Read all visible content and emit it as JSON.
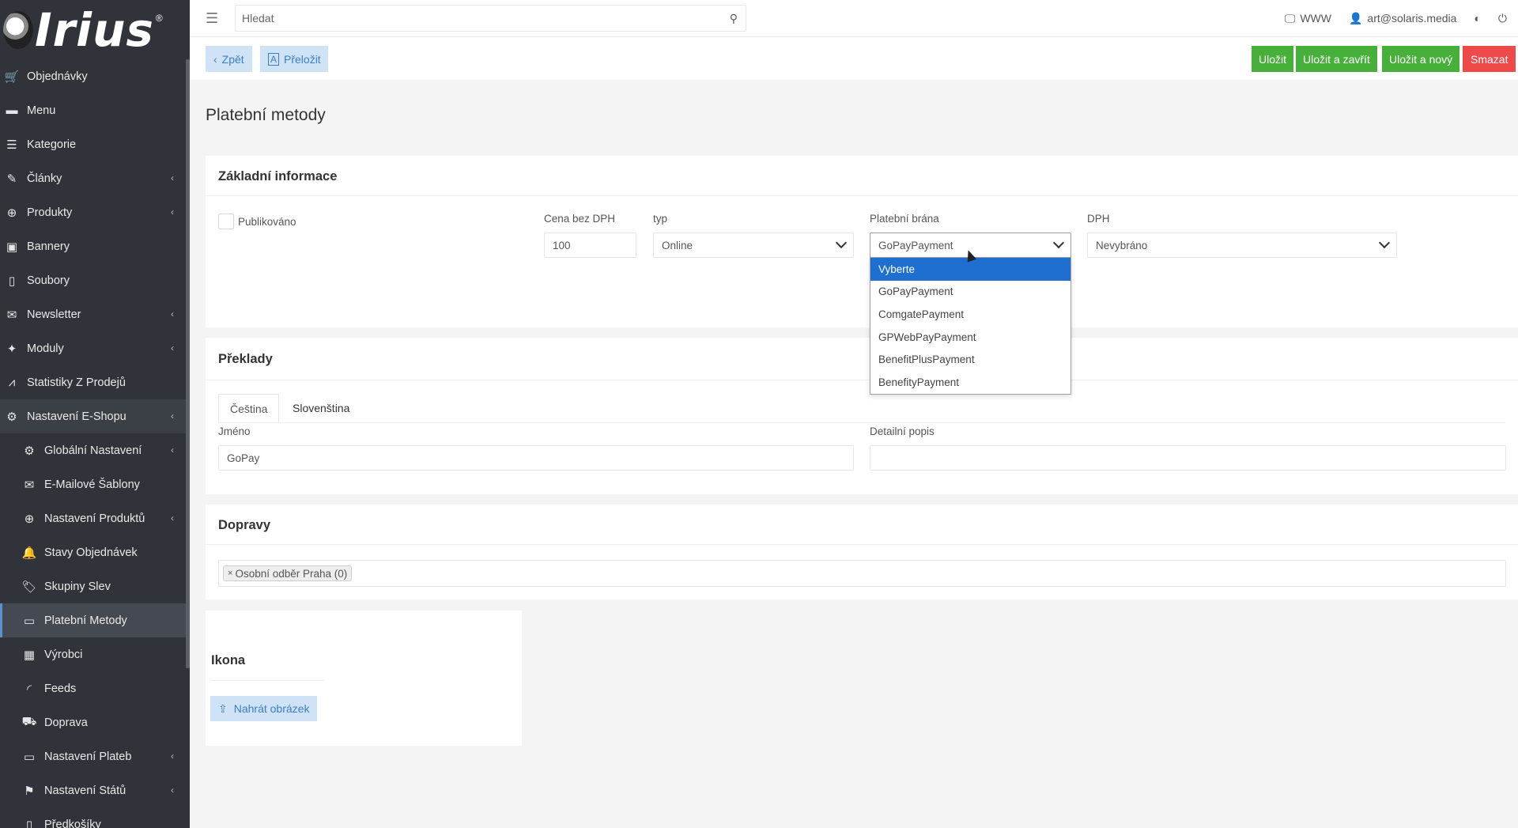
{
  "app": {
    "logo_text": "Irius",
    "logo_reg": "®"
  },
  "sidebar": {
    "items": [
      {
        "label": "Objednávky",
        "icon": "cart-icon",
        "glyph": "🛒",
        "chev": false
      },
      {
        "label": "Menu",
        "icon": "folder-icon",
        "glyph": "▬",
        "chev": false
      },
      {
        "label": "Kategorie",
        "icon": "list-icon",
        "glyph": "☰",
        "chev": false
      },
      {
        "label": "Články",
        "icon": "pencil-icon",
        "glyph": "✎",
        "chev": true
      },
      {
        "label": "Produkty",
        "icon": "globe-icon",
        "glyph": "⊕",
        "chev": true
      },
      {
        "label": "Bannery",
        "icon": "image-icon",
        "glyph": "▣",
        "chev": false
      },
      {
        "label": "Soubory",
        "icon": "file-icon",
        "glyph": "▯",
        "chev": false
      },
      {
        "label": "Newsletter",
        "icon": "mail-icon",
        "glyph": "✉",
        "chev": true
      },
      {
        "label": "Moduly",
        "icon": "puzzle-icon",
        "glyph": "✦",
        "chev": true
      },
      {
        "label": "Statistiky Z Prodejů",
        "icon": "chart-icon",
        "glyph": "⩘",
        "chev": false
      },
      {
        "label": "Nastavení E-Shopu",
        "icon": "cogs-icon",
        "glyph": "⚙",
        "chev": true,
        "open": true
      }
    ],
    "subitems": [
      {
        "label": "Globální Nastavení",
        "icon": "gear-icon",
        "glyph": "⚙",
        "chev": true
      },
      {
        "label": "E-Mailové Šablony",
        "icon": "envelope-icon",
        "glyph": "✉",
        "chev": false
      },
      {
        "label": "Nastavení Produktů",
        "icon": "globe-icon",
        "glyph": "⊕",
        "chev": true
      },
      {
        "label": "Stavy Objednávek",
        "icon": "bell-icon",
        "glyph": "🔔",
        "chev": false
      },
      {
        "label": "Skupiny Slev",
        "icon": "tag-icon",
        "glyph": "🏷",
        "chev": false
      },
      {
        "label": "Platební Metody",
        "icon": "credit-card-icon",
        "glyph": "▭",
        "chev": false,
        "active": true
      },
      {
        "label": "Výrobci",
        "icon": "building-icon",
        "glyph": "▦",
        "chev": false
      },
      {
        "label": "Feeds",
        "icon": "rss-icon",
        "glyph": "◜",
        "chev": false
      },
      {
        "label": "Doprava",
        "icon": "truck-icon",
        "glyph": "⛟",
        "chev": false
      },
      {
        "label": "Nastavení Plateb",
        "icon": "credit-card-icon",
        "glyph": "▭",
        "chev": true
      },
      {
        "label": "Nastavení Států",
        "icon": "flag-icon",
        "glyph": "⚑",
        "chev": true
      },
      {
        "label": "Předkošíky",
        "icon": "file-icon",
        "glyph": "▯",
        "chev": false
      }
    ]
  },
  "topbar": {
    "search_placeholder": "Hledat",
    "www_label": "WWW",
    "user_email": "art@solaris.media"
  },
  "actions": {
    "back": "Zpět",
    "translate": "Přeložit",
    "save": "Uložit",
    "save_close": "Uložit a zavřít",
    "save_new": "Uložit a nový",
    "delete": "Smazat"
  },
  "page": {
    "title": "Platební metody"
  },
  "basic": {
    "title": "Základní informace",
    "published_label": "Publikováno",
    "price_label": "Cena bez DPH",
    "price_value": "100",
    "type_label": "typ",
    "type_value": "Online",
    "gateway_label": "Platební brána",
    "gateway_value": "GoPayPayment",
    "vat_label": "DPH",
    "vat_value": "Nevybráno"
  },
  "dropdown": {
    "options": [
      "Vyberte",
      "GoPayPayment",
      "ComgatePayment",
      "GPWebPayPayment",
      "BenefitPlusPayment",
      "BenefityPayment"
    ]
  },
  "translations": {
    "title": "Překlady",
    "tab_cs": "Čeština",
    "tab_sk": "Slovenština",
    "name_label": "Jméno",
    "name_value": "GoPay",
    "desc_label": "Detailní popis",
    "desc_value": ""
  },
  "shipping": {
    "title": "Dopravy",
    "tag_remove": "×",
    "tag_label": "Osobní odběr Praha (0)"
  },
  "icon_card": {
    "title": "Ikona",
    "upload_label": "Nahrát obrázek"
  }
}
